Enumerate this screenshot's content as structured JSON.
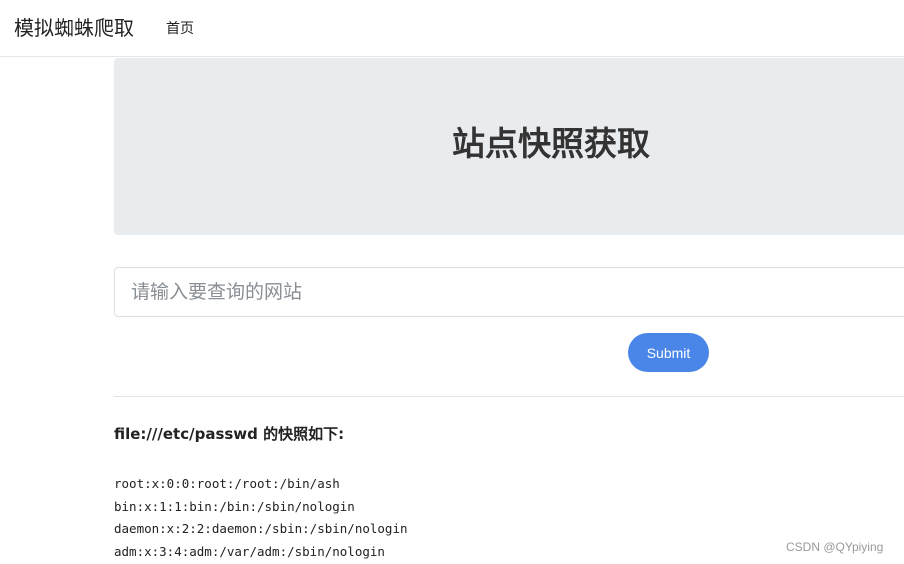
{
  "navbar": {
    "brand": "模拟蜘蛛爬取",
    "links": [
      "首页"
    ]
  },
  "jumbotron": {
    "title": "站点快照获取"
  },
  "form": {
    "input_placeholder": "请输入要查询的网站",
    "input_value": "",
    "submit_label": "Submit"
  },
  "result": {
    "heading": "file:///etc/passwd 的快照如下:",
    "lines": [
      "root:x:0:0:root:/root:/bin/ash",
      "bin:x:1:1:bin:/bin:/sbin/nologin",
      "daemon:x:2:2:daemon:/sbin:/sbin/nologin",
      "adm:x:3:4:adm:/var/adm:/sbin/nologin"
    ]
  },
  "watermark": "CSDN @QYpiying",
  "colors": {
    "primary_button": "#4a86e8",
    "jumbotron_bg": "#e9ecef"
  }
}
